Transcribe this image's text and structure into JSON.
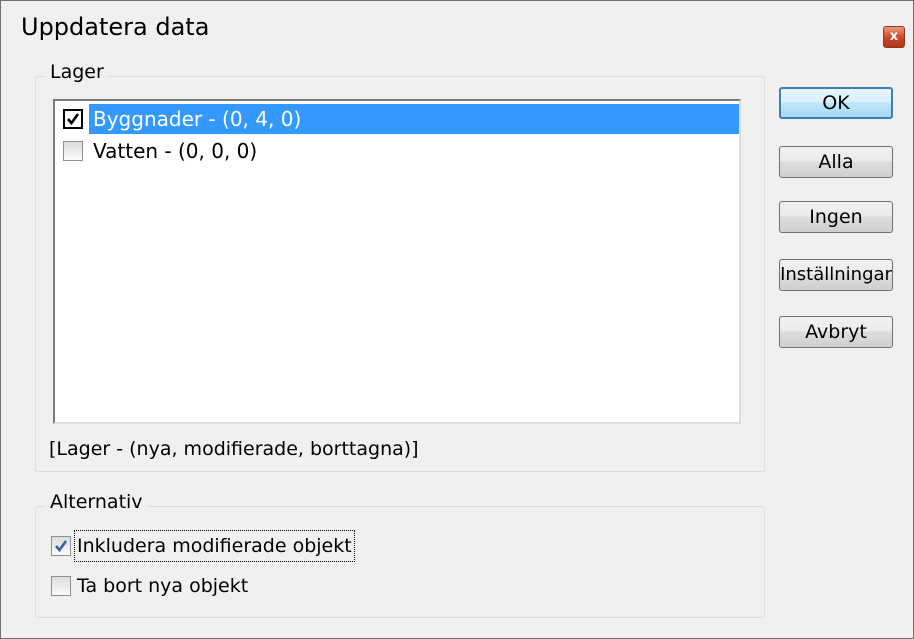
{
  "window": {
    "title": "Uppdatera data",
    "close_label": "x"
  },
  "layers_group": {
    "label": "Lager",
    "items": [
      {
        "label": "Byggnader - (0, 4, 0)",
        "checked": true,
        "selected": true
      },
      {
        "label": "Vatten - (0, 0, 0)",
        "checked": false,
        "selected": false
      }
    ],
    "legend": "[Lager - (nya, modifierade, borttagna)]"
  },
  "buttons": {
    "ok": "OK",
    "all": "Alla",
    "none": "Ingen",
    "settings": "Inställningar",
    "cancel": "Avbryt"
  },
  "options_group": {
    "label": "Alternativ",
    "include_modified": {
      "label": "Inkludera modifierade objekt",
      "checked": true
    },
    "remove_new": {
      "label": "Ta bort nya objekt",
      "checked": false
    }
  },
  "colors": {
    "selection": "#3399ff",
    "check_blue": "#3b5ca8"
  }
}
